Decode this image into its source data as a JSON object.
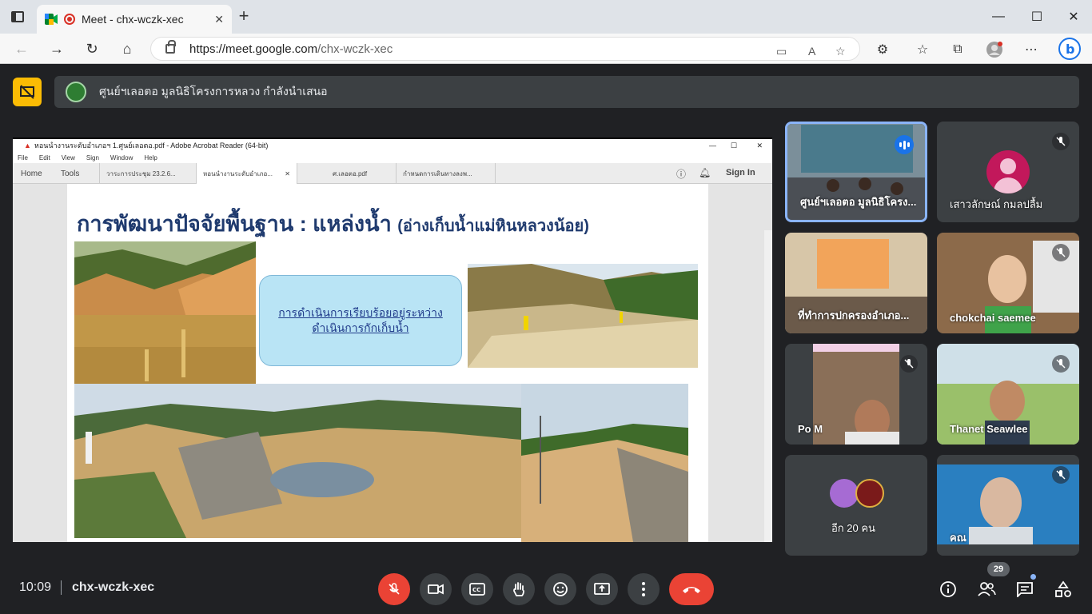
{
  "browser": {
    "tab_title": "Meet - chx-wczk-xec",
    "url_host": "https://meet.google.com",
    "url_path": "/chx-wczk-xec"
  },
  "meet": {
    "presenting_banner": "ศูนย์ฯเลอตอ มูลนิธิโครงการหลวง กำลังนำเสนอ",
    "time": "10:09",
    "meeting_code": "chx-wczk-xec",
    "participant_count": "29",
    "colors": {
      "accent_yellow": "#fbbc04",
      "hangup_red": "#ea4335",
      "speaking_blue": "#8ab4f8",
      "surface": "#202124"
    }
  },
  "acrobat": {
    "window_title": "หอนนำงานระดับอำเภอฯ 1.ศูนย์เลอตอ.pdf - Adobe Acrobat Reader (64-bit)",
    "menu": [
      "File",
      "Edit",
      "View",
      "Sign",
      "Window",
      "Help"
    ],
    "tabs": [
      {
        "label": "Home"
      },
      {
        "label": "Tools"
      },
      {
        "label": "วาระการประชุม 23.2.6..."
      },
      {
        "label": "หอนนำงานระดับอำเภอ..."
      },
      {
        "label": "ศ.เลอตอ.pdf"
      },
      {
        "label": "กำหนดการเดินทางลงพ..."
      }
    ],
    "sign_in": "Sign In"
  },
  "slide": {
    "title": "การพัฒนาปัจจัยพื้นฐาน : แหล่งน้ำ",
    "subtitle": "(อ่างเก็บน้ำแม่หินหลวงน้อย)",
    "callout_line1": "การดำเนินการเรียบร้อยอยู่ระหว่าง",
    "callout_line2": "ดำเนินการกักเก็บน้ำ"
  },
  "participants": [
    {
      "name": "ศูนย์ฯเลอตอ มูลนิธิโครง...",
      "speaking": true
    },
    {
      "name": "เสาวลักษณ์ กมลปลื้ม",
      "muted": true
    },
    {
      "name": "ที่ทำการปกครองอำเภอ..."
    },
    {
      "name": "chokchai saemee",
      "muted": true
    },
    {
      "name": "Po M",
      "muted": true
    },
    {
      "name": "Thanet Seawlee",
      "muted": true
    },
    {
      "name": "อีก 20 คน"
    },
    {
      "name": "คณ",
      "muted": true
    }
  ]
}
